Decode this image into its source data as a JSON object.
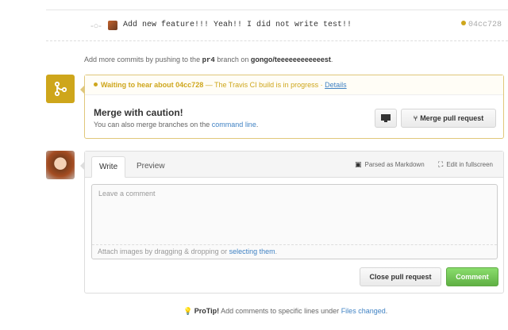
{
  "commit": {
    "message": "Add new feature!!! Yeah!! I did not write test!!",
    "sha": "04cc728",
    "status_color": "#cea61b"
  },
  "push_note": {
    "prefix": "Add more commits by pushing to the",
    "branch": "pr4",
    "middle": "branch on",
    "repo": "gongo/teeeeeeeeeeeest",
    "suffix": "."
  },
  "merge": {
    "icon": "git-merge-icon",
    "status_bold": "Waiting to hear about 04cc728",
    "status_rest": "— The Travis CI build is in progress ·",
    "status_link": "Details",
    "title": "Merge with caution!",
    "sub_text": "You can also merge branches on the",
    "sub_link": "command line",
    "sub_end": ".",
    "merge_button": "Merge pull request",
    "accent": "#cea61b"
  },
  "comment": {
    "tab_write": "Write",
    "tab_preview": "Preview",
    "parsed_markdown": "Parsed as Markdown",
    "fullscreen": "Edit in fullscreen",
    "placeholder": "Leave a comment",
    "attach_text": "Attach images by dragging & dropping or",
    "attach_link": "selecting them",
    "attach_end": ".",
    "close_button": "Close pull request",
    "comment_button": "Comment"
  },
  "protip": {
    "label": "ProTip!",
    "text": "Add comments to specific lines under",
    "link": "Files changed",
    "end": "."
  }
}
